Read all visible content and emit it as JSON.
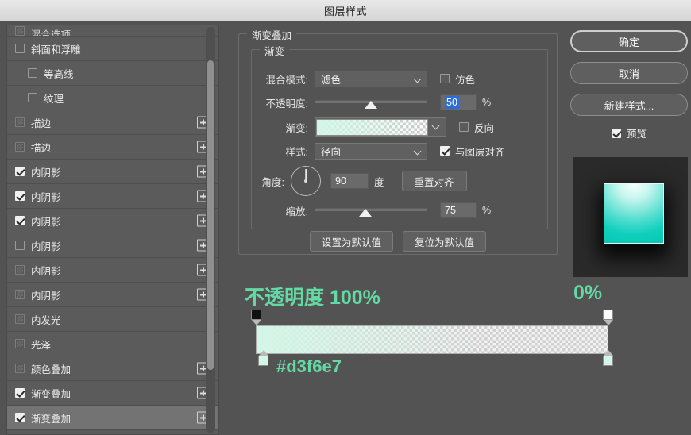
{
  "window": {
    "title": "图层样式"
  },
  "sidebar": {
    "items": [
      {
        "label": "混合选项",
        "checked": false,
        "dim": true,
        "indent": false,
        "plus": false,
        "selected": false,
        "clipped": true
      },
      {
        "label": "斜面和浮雕",
        "checked": false,
        "dim": false,
        "indent": false,
        "plus": false,
        "selected": false,
        "clipped": false
      },
      {
        "label": "等高线",
        "checked": false,
        "dim": false,
        "indent": true,
        "plus": false,
        "selected": false,
        "clipped": false
      },
      {
        "label": "纹理",
        "checked": false,
        "dim": false,
        "indent": true,
        "plus": false,
        "selected": false,
        "clipped": false
      },
      {
        "label": "描边",
        "checked": false,
        "dim": true,
        "indent": false,
        "plus": true,
        "selected": false,
        "clipped": false
      },
      {
        "label": "描边",
        "checked": false,
        "dim": true,
        "indent": false,
        "plus": true,
        "selected": false,
        "clipped": false
      },
      {
        "label": "内阴影",
        "checked": true,
        "dim": false,
        "indent": false,
        "plus": true,
        "selected": false,
        "clipped": false
      },
      {
        "label": "内阴影",
        "checked": true,
        "dim": false,
        "indent": false,
        "plus": true,
        "selected": false,
        "clipped": false
      },
      {
        "label": "内阴影",
        "checked": true,
        "dim": false,
        "indent": false,
        "plus": true,
        "selected": false,
        "clipped": false
      },
      {
        "label": "内阴影",
        "checked": false,
        "dim": false,
        "indent": false,
        "plus": true,
        "selected": false,
        "clipped": false
      },
      {
        "label": "内阴影",
        "checked": false,
        "dim": true,
        "indent": false,
        "plus": true,
        "selected": false,
        "clipped": false
      },
      {
        "label": "内阴影",
        "checked": false,
        "dim": true,
        "indent": false,
        "plus": true,
        "selected": false,
        "clipped": false
      },
      {
        "label": "内发光",
        "checked": false,
        "dim": true,
        "indent": false,
        "plus": false,
        "selected": false,
        "clipped": false
      },
      {
        "label": "光泽",
        "checked": false,
        "dim": true,
        "indent": false,
        "plus": false,
        "selected": false,
        "clipped": false
      },
      {
        "label": "颜色叠加",
        "checked": false,
        "dim": true,
        "indent": false,
        "plus": true,
        "selected": false,
        "clipped": false
      },
      {
        "label": "渐变叠加",
        "checked": true,
        "dim": false,
        "indent": false,
        "plus": true,
        "selected": false,
        "clipped": false
      },
      {
        "label": "渐变叠加",
        "checked": true,
        "dim": false,
        "indent": false,
        "plus": true,
        "selected": true,
        "clipped": false
      }
    ]
  },
  "panel": {
    "section_title": "渐变叠加",
    "group_title": "渐变",
    "blend_mode": {
      "label": "混合模式:",
      "value": "滤色"
    },
    "dither": {
      "label": "仿色",
      "checked": false
    },
    "opacity": {
      "label": "不透明度:",
      "value": "50",
      "unit": "%",
      "slider_percent": 50
    },
    "gradient": {
      "label": "渐变:"
    },
    "reverse": {
      "label": "反向",
      "checked": false
    },
    "style": {
      "label": "样式:",
      "value": "径向"
    },
    "align_with_layer": {
      "label": "与图层对齐",
      "checked": true
    },
    "angle": {
      "label": "角度:",
      "value": "90",
      "unit": "度"
    },
    "reset_align_button": "重置对齐",
    "scale": {
      "label": "缩放:",
      "value": "75",
      "unit": "%",
      "slider_percent": 45
    },
    "set_default_button": "设置为默认值",
    "reset_default_button": "复位为默认值"
  },
  "right": {
    "ok_button": "确定",
    "cancel_button": "取消",
    "new_style_button": "新建样式...",
    "preview": {
      "label": "预览",
      "checked": true
    }
  },
  "annotations": {
    "opacity_left": "不透明度 100%",
    "opacity_right": "0%",
    "color_hex": "#d3f6e7",
    "accent_color": "#63d9a4"
  }
}
